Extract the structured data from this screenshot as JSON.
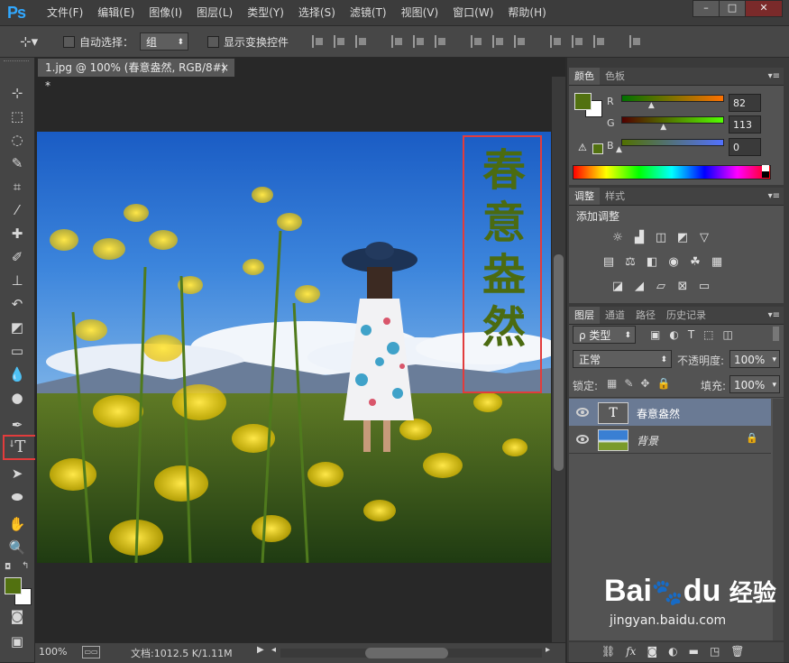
{
  "app": {
    "logo": "Ps"
  },
  "menu": [
    "文件(F)",
    "编辑(E)",
    "图像(I)",
    "图层(L)",
    "类型(Y)",
    "选择(S)",
    "滤镜(T)",
    "视图(V)",
    "窗口(W)",
    "帮助(H)"
  ],
  "window_buttons": [
    "–",
    "□",
    "✕"
  ],
  "options": {
    "auto_select_label": "自动选择：",
    "auto_select_value": "组",
    "transform_label": "显示变换控件"
  },
  "document": {
    "tab_title": "1.jpg @ 100% (春意盎然, RGB/8#) *",
    "tab_close": "×",
    "text_chars": [
      "春",
      "意",
      "盎",
      "然"
    ],
    "text_color": "#4b6b11"
  },
  "statusbar": {
    "zoom": "100%",
    "doc_info": "文档:1012.5 K/1.11M"
  },
  "color_panel": {
    "tabs": [
      "颜色",
      "色板"
    ],
    "fg_color": "#527110",
    "channels": [
      {
        "label": "R",
        "value": "82",
        "fraction": 0.32
      },
      {
        "label": "G",
        "value": "113",
        "fraction": 0.44
      },
      {
        "label": "B",
        "value": "0",
        "fraction": 0.0
      }
    ]
  },
  "adjust_panel": {
    "tabs": [
      "调整",
      "样式"
    ],
    "title": "添加调整"
  },
  "layers_panel": {
    "tabs": [
      "图层",
      "通道",
      "路径",
      "历史记录"
    ],
    "filter_label": "ρ 类型",
    "blend_mode": "正常",
    "opacity_label": "不透明度:",
    "opacity_value": "100%",
    "lock_label": "锁定:",
    "fill_label": "填充:",
    "fill_value": "100%",
    "layers": [
      {
        "name": "春意盎然",
        "type": "text",
        "thumb": "T",
        "selected": true
      },
      {
        "name": "背景",
        "type": "image",
        "selected": false
      }
    ]
  },
  "watermark": {
    "brand": "Bai",
    "brand2": "du",
    "cn": "经验",
    "url": "jingyan.baidu.com"
  }
}
